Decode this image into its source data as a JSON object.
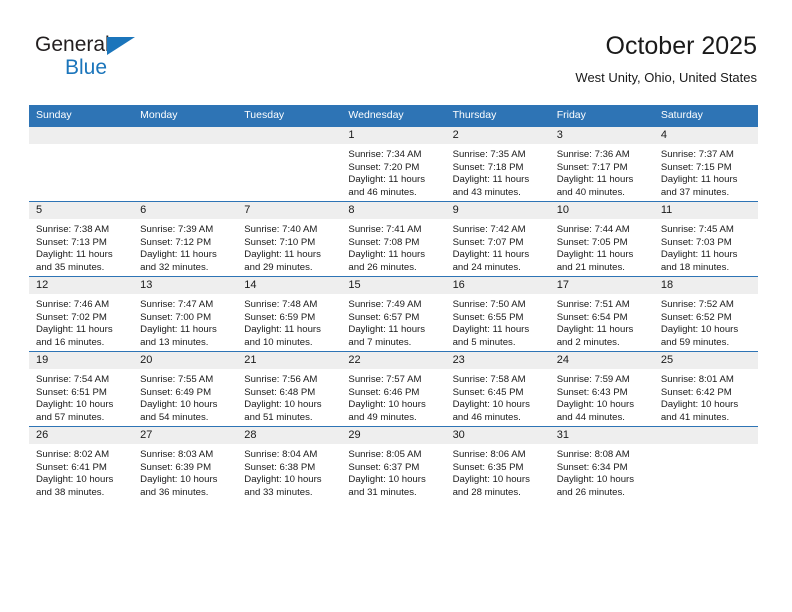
{
  "brand": {
    "name_top": "General",
    "name_bottom": "Blue",
    "triangle_color": "#1b75bb"
  },
  "header": {
    "title": "October 2025",
    "subtitle": "West Unity, Ohio, United States"
  },
  "theme": {
    "header_blue": "#2e74b5",
    "daynum_gray": "#eeeeee",
    "text": "#1a1a1a"
  },
  "weekdays": [
    "Sunday",
    "Monday",
    "Tuesday",
    "Wednesday",
    "Thursday",
    "Friday",
    "Saturday"
  ],
  "labels": {
    "sunrise_prefix": "Sunrise: ",
    "sunset_prefix": "Sunset: ",
    "daylight_prefix": "Daylight: "
  },
  "weeks": [
    [
      {
        "day": "",
        "empty": true
      },
      {
        "day": "",
        "empty": true
      },
      {
        "day": "",
        "empty": true
      },
      {
        "day": "1",
        "sunrise": "Sunrise: 7:34 AM",
        "sunset": "Sunset: 7:20 PM",
        "daylight": "Daylight: 11 hours and 46 minutes."
      },
      {
        "day": "2",
        "sunrise": "Sunrise: 7:35 AM",
        "sunset": "Sunset: 7:18 PM",
        "daylight": "Daylight: 11 hours and 43 minutes."
      },
      {
        "day": "3",
        "sunrise": "Sunrise: 7:36 AM",
        "sunset": "Sunset: 7:17 PM",
        "daylight": "Daylight: 11 hours and 40 minutes."
      },
      {
        "day": "4",
        "sunrise": "Sunrise: 7:37 AM",
        "sunset": "Sunset: 7:15 PM",
        "daylight": "Daylight: 11 hours and 37 minutes."
      }
    ],
    [
      {
        "day": "5",
        "sunrise": "Sunrise: 7:38 AM",
        "sunset": "Sunset: 7:13 PM",
        "daylight": "Daylight: 11 hours and 35 minutes."
      },
      {
        "day": "6",
        "sunrise": "Sunrise: 7:39 AM",
        "sunset": "Sunset: 7:12 PM",
        "daylight": "Daylight: 11 hours and 32 minutes."
      },
      {
        "day": "7",
        "sunrise": "Sunrise: 7:40 AM",
        "sunset": "Sunset: 7:10 PM",
        "daylight": "Daylight: 11 hours and 29 minutes."
      },
      {
        "day": "8",
        "sunrise": "Sunrise: 7:41 AM",
        "sunset": "Sunset: 7:08 PM",
        "daylight": "Daylight: 11 hours and 26 minutes."
      },
      {
        "day": "9",
        "sunrise": "Sunrise: 7:42 AM",
        "sunset": "Sunset: 7:07 PM",
        "daylight": "Daylight: 11 hours and 24 minutes."
      },
      {
        "day": "10",
        "sunrise": "Sunrise: 7:44 AM",
        "sunset": "Sunset: 7:05 PM",
        "daylight": "Daylight: 11 hours and 21 minutes."
      },
      {
        "day": "11",
        "sunrise": "Sunrise: 7:45 AM",
        "sunset": "Sunset: 7:03 PM",
        "daylight": "Daylight: 11 hours and 18 minutes."
      }
    ],
    [
      {
        "day": "12",
        "sunrise": "Sunrise: 7:46 AM",
        "sunset": "Sunset: 7:02 PM",
        "daylight": "Daylight: 11 hours and 16 minutes."
      },
      {
        "day": "13",
        "sunrise": "Sunrise: 7:47 AM",
        "sunset": "Sunset: 7:00 PM",
        "daylight": "Daylight: 11 hours and 13 minutes."
      },
      {
        "day": "14",
        "sunrise": "Sunrise: 7:48 AM",
        "sunset": "Sunset: 6:59 PM",
        "daylight": "Daylight: 11 hours and 10 minutes."
      },
      {
        "day": "15",
        "sunrise": "Sunrise: 7:49 AM",
        "sunset": "Sunset: 6:57 PM",
        "daylight": "Daylight: 11 hours and 7 minutes."
      },
      {
        "day": "16",
        "sunrise": "Sunrise: 7:50 AM",
        "sunset": "Sunset: 6:55 PM",
        "daylight": "Daylight: 11 hours and 5 minutes."
      },
      {
        "day": "17",
        "sunrise": "Sunrise: 7:51 AM",
        "sunset": "Sunset: 6:54 PM",
        "daylight": "Daylight: 11 hours and 2 minutes."
      },
      {
        "day": "18",
        "sunrise": "Sunrise: 7:52 AM",
        "sunset": "Sunset: 6:52 PM",
        "daylight": "Daylight: 10 hours and 59 minutes."
      }
    ],
    [
      {
        "day": "19",
        "sunrise": "Sunrise: 7:54 AM",
        "sunset": "Sunset: 6:51 PM",
        "daylight": "Daylight: 10 hours and 57 minutes."
      },
      {
        "day": "20",
        "sunrise": "Sunrise: 7:55 AM",
        "sunset": "Sunset: 6:49 PM",
        "daylight": "Daylight: 10 hours and 54 minutes."
      },
      {
        "day": "21",
        "sunrise": "Sunrise: 7:56 AM",
        "sunset": "Sunset: 6:48 PM",
        "daylight": "Daylight: 10 hours and 51 minutes."
      },
      {
        "day": "22",
        "sunrise": "Sunrise: 7:57 AM",
        "sunset": "Sunset: 6:46 PM",
        "daylight": "Daylight: 10 hours and 49 minutes."
      },
      {
        "day": "23",
        "sunrise": "Sunrise: 7:58 AM",
        "sunset": "Sunset: 6:45 PM",
        "daylight": "Daylight: 10 hours and 46 minutes."
      },
      {
        "day": "24",
        "sunrise": "Sunrise: 7:59 AM",
        "sunset": "Sunset: 6:43 PM",
        "daylight": "Daylight: 10 hours and 44 minutes."
      },
      {
        "day": "25",
        "sunrise": "Sunrise: 8:01 AM",
        "sunset": "Sunset: 6:42 PM",
        "daylight": "Daylight: 10 hours and 41 minutes."
      }
    ],
    [
      {
        "day": "26",
        "sunrise": "Sunrise: 8:02 AM",
        "sunset": "Sunset: 6:41 PM",
        "daylight": "Daylight: 10 hours and 38 minutes."
      },
      {
        "day": "27",
        "sunrise": "Sunrise: 8:03 AM",
        "sunset": "Sunset: 6:39 PM",
        "daylight": "Daylight: 10 hours and 36 minutes."
      },
      {
        "day": "28",
        "sunrise": "Sunrise: 8:04 AM",
        "sunset": "Sunset: 6:38 PM",
        "daylight": "Daylight: 10 hours and 33 minutes."
      },
      {
        "day": "29",
        "sunrise": "Sunrise: 8:05 AM",
        "sunset": "Sunset: 6:37 PM",
        "daylight": "Daylight: 10 hours and 31 minutes."
      },
      {
        "day": "30",
        "sunrise": "Sunrise: 8:06 AM",
        "sunset": "Sunset: 6:35 PM",
        "daylight": "Daylight: 10 hours and 28 minutes."
      },
      {
        "day": "31",
        "sunrise": "Sunrise: 8:08 AM",
        "sunset": "Sunset: 6:34 PM",
        "daylight": "Daylight: 10 hours and 26 minutes."
      },
      {
        "day": "",
        "empty": true
      }
    ]
  ]
}
